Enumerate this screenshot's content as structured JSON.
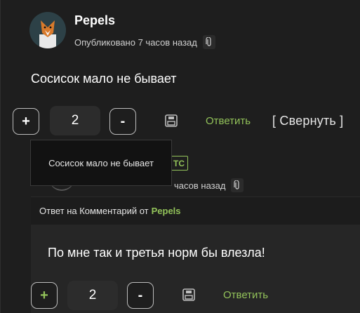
{
  "comment": {
    "author": "Pepels",
    "published": "Опубликовано 7 часов назад",
    "text": "Сосисок мало не бывает",
    "vote_plus": "+",
    "vote_count": "2",
    "vote_minus": "-",
    "reply_label": "Ответить",
    "collapse_label": "[ Свернуть ]"
  },
  "tooltip": {
    "text": "Сосисок мало не бывает"
  },
  "reply": {
    "badge": "ТС",
    "published_partial": "часов назад",
    "reply_to_prefix": "Ответ на Комментарий от",
    "reply_to_author": "Pepels",
    "text": "По мне так и третья норм бы влезла!",
    "vote_plus": "+",
    "vote_count": "2",
    "vote_minus": "-",
    "reply_label": "Ответить"
  },
  "colors": {
    "accent_green": "#93c35a",
    "background": "#1e1e1e"
  },
  "icons": [
    "paperclip-icon",
    "save-icon",
    "fox-avatar"
  ]
}
